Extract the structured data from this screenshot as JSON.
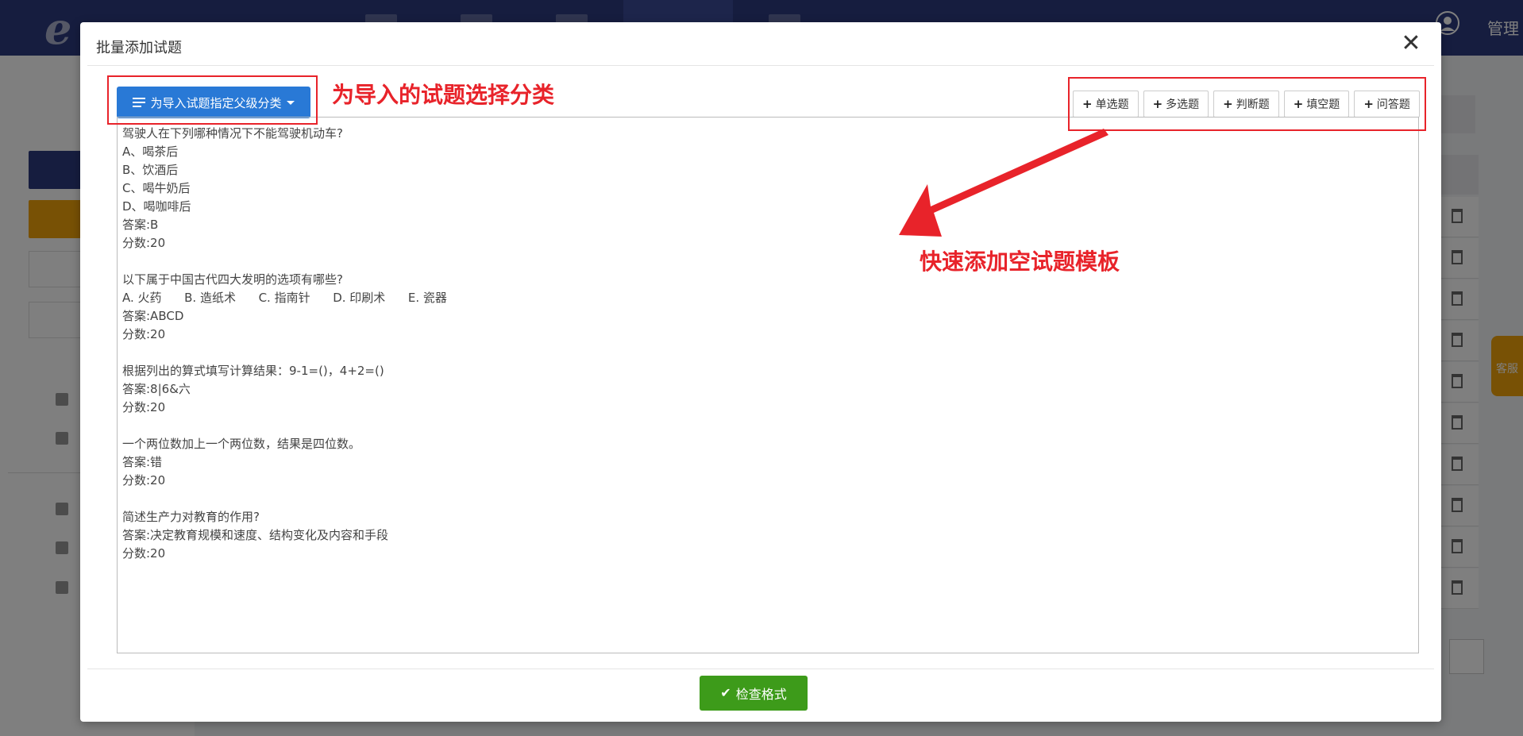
{
  "app": {
    "admin_label": "管理",
    "service_label": "客服"
  },
  "modal": {
    "title": "批量添加试题",
    "close_label": "✕",
    "category_button_label": "为导入试题指定父级分类",
    "template_buttons": [
      "单选题",
      "多选题",
      "判断题",
      "填空题",
      "问答题"
    ],
    "check_button_label": "检查格式",
    "editor_lines": [
      "驾驶人在下列哪种情况下不能驾驶机动车?",
      "A、喝茶后",
      "B、饮酒后",
      "C、喝牛奶后",
      "D、喝咖啡后",
      "答案:B",
      "分数:20",
      "",
      "以下属于中国古代四大发明的选项有哪些?",
      "A. 火药      B. 造纸术      C. 指南针      D. 印刷术      E. 瓷器",
      "答案:ABCD",
      "分数:20",
      "",
      "根据列出的算式填写计算结果：9-1=()，4+2=()",
      "答案:8|6&六",
      "分数:20",
      "",
      "一个两位数加上一个两位数，结果是四位数。",
      "答案:错",
      "分数:20",
      "",
      "简述生产力对教育的作用?",
      "答案:决定教育规模和速度、结构变化及内容和手段",
      "分数:20"
    ]
  },
  "annotations": {
    "category_note": "为导入的试题选择分类",
    "template_note": "快速添加空试题模板",
    "color": "#e8232a"
  },
  "colors": {
    "topbar": "#2d3a7f",
    "primary_button": "#2979d6",
    "success_button": "#3d9b1a",
    "warning": "#f0a30a"
  }
}
